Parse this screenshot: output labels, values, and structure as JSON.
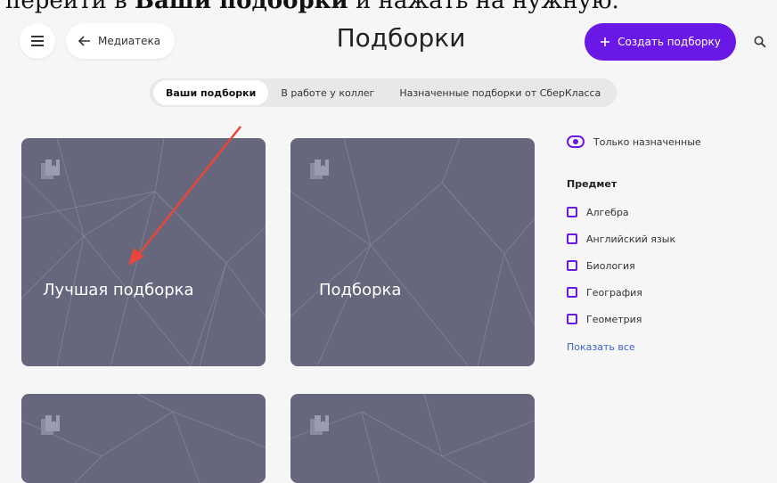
{
  "caption": {
    "prefix": "перейти в ",
    "bold": "Ваши подборки",
    "suffix": " и нажать на нужную."
  },
  "header": {
    "back_label": "Медиатека",
    "title": "Подборки",
    "create_label": "Создать подборку"
  },
  "tabs": [
    {
      "label": "Ваши подборки",
      "active": true
    },
    {
      "label": "В работе у коллег",
      "active": false
    },
    {
      "label": "Назначенные подборки от СберКласса",
      "active": false
    }
  ],
  "cards": [
    {
      "title": "Лучшая подборка"
    },
    {
      "title": "Подборка"
    },
    {
      "title": ""
    },
    {
      "title": ""
    }
  ],
  "filters": {
    "toggle_label": "Только назначенные",
    "subject_title": "Предмет",
    "subjects": [
      "Алгебра",
      "Английский язык",
      "Биология",
      "География",
      "Геометрия"
    ],
    "show_all": "Показать все"
  },
  "colors": {
    "accent": "#6a18e6",
    "card_bg": "#66667c",
    "link": "#3a62c6",
    "arrow": "#e8463a"
  }
}
